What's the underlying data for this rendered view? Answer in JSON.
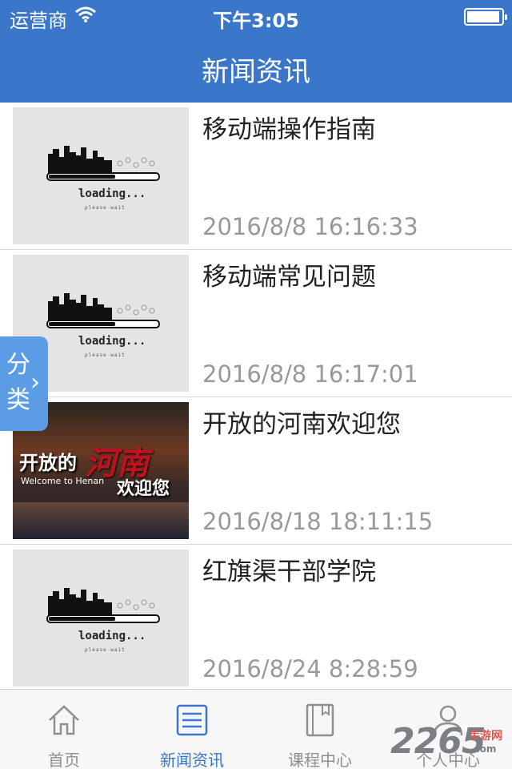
{
  "status_bar": {
    "carrier": "运营商",
    "time": "下午3:05"
  },
  "nav": {
    "title": "新闻资讯"
  },
  "news": [
    {
      "title": "移动端操作指南",
      "date": "2016/8/8 16:16:33",
      "thumb_text": "loading...",
      "thumb_sub": "please wait"
    },
    {
      "title": "移动端常见问题",
      "date": "2016/8/8 16:17:01",
      "thumb_text": "loading...",
      "thumb_sub": "please wait"
    },
    {
      "title": "开放的河南欢迎您",
      "date": "2016/8/18 18:11:15",
      "banner": {
        "t1": "开放的",
        "t2": "河南",
        "t3": "Welcome to Henan",
        "t4": "欢迎您"
      }
    },
    {
      "title": "红旗渠干部学院",
      "date": "2016/8/24 8:28:59",
      "thumb_text": "loading...",
      "thumb_sub": "please wait"
    }
  ],
  "side_tab": {
    "label": "分类"
  },
  "tabs": [
    {
      "label": "首页",
      "icon": "home-icon"
    },
    {
      "label": "新闻资讯",
      "icon": "news-list-icon",
      "active": true
    },
    {
      "label": "课程中心",
      "icon": "book-icon"
    },
    {
      "label": "个人中心",
      "icon": "user-icon"
    }
  ],
  "watermark": {
    "logo": "2265",
    "site": "手游网",
    "domain": ".com"
  },
  "colors": {
    "accent": "#3a76c9",
    "side_tab": "#5c9ce4",
    "muted": "#999999"
  }
}
